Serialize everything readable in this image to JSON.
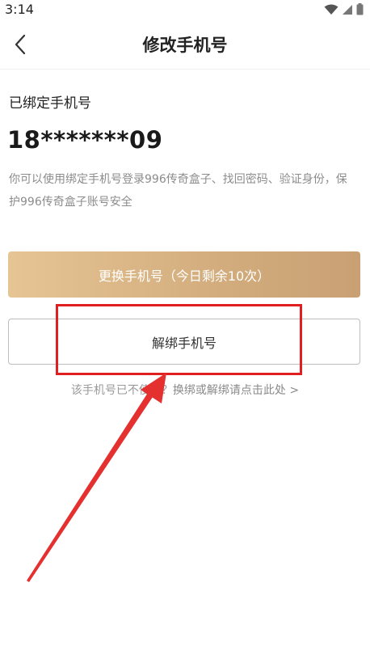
{
  "status_bar": {
    "time": "3:14"
  },
  "nav": {
    "title": "修改手机号"
  },
  "content": {
    "bound_label": "已绑定手机号",
    "phone_number": "18*******09",
    "description": "你可以使用绑定手机号登录996传奇盒子、找回密码、验证身份，保护996传奇盒子账号安全",
    "change_button_label": "更换手机号（今日剩余10次）",
    "unbind_button_label": "解绑手机号",
    "hint_text": "该手机号已不使用？",
    "hint_link": "换绑或解绑请点击此处 >"
  },
  "colors": {
    "change_button_gradient": [
      "#e6c595",
      "#c8a074"
    ],
    "annotation_red": "#e02020"
  },
  "icons": {
    "back": "chevron-left-icon",
    "wifi": "wifi-icon",
    "signal": "signal-icon",
    "battery": "battery-icon"
  }
}
